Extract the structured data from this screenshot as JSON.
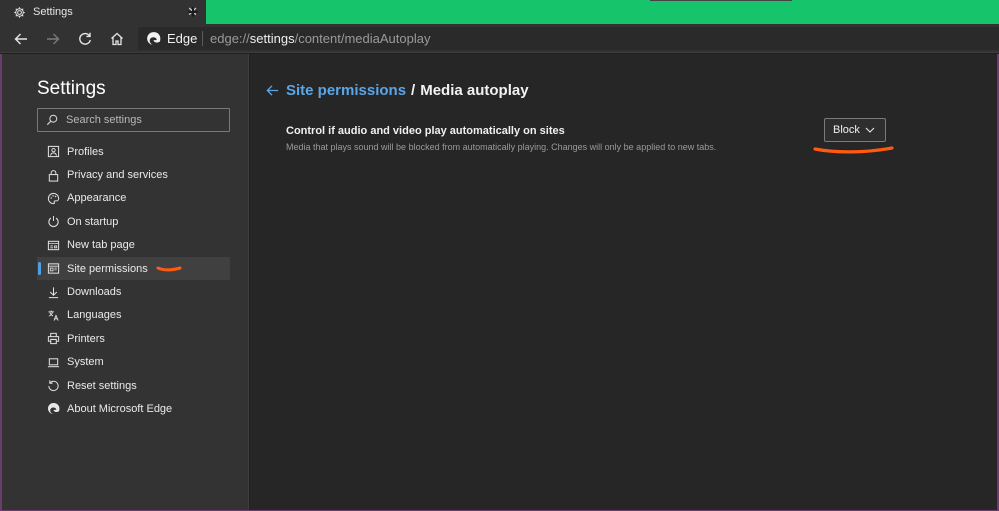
{
  "window": {
    "tab_title": "Settings",
    "tab_icon": "gear-icon",
    "close_glyph": "✕",
    "new_tab_glyph": "+"
  },
  "toolbar": {
    "brand": "Edge",
    "url_scheme": "edge://",
    "url_host": "settings",
    "url_path": "/content/mediaAutoplay"
  },
  "sidebar": {
    "title": "Settings",
    "search_placeholder": "Search settings",
    "items": [
      {
        "label": "Profiles",
        "icon": "profile-icon"
      },
      {
        "label": "Privacy and services",
        "icon": "lock-icon"
      },
      {
        "label": "Appearance",
        "icon": "palette-icon"
      },
      {
        "label": "On startup",
        "icon": "power-icon"
      },
      {
        "label": "New tab page",
        "icon": "new-tab-icon"
      },
      {
        "label": "Site permissions",
        "icon": "site-permissions-icon",
        "selected": true
      },
      {
        "label": "Downloads",
        "icon": "download-icon"
      },
      {
        "label": "Languages",
        "icon": "languages-icon"
      },
      {
        "label": "Printers",
        "icon": "printer-icon"
      },
      {
        "label": "System",
        "icon": "laptop-icon"
      },
      {
        "label": "Reset settings",
        "icon": "reset-icon"
      },
      {
        "label": "About Microsoft Edge",
        "icon": "edge-logo-icon"
      }
    ]
  },
  "main": {
    "breadcrumb_link": "Site permissions",
    "breadcrumb_sep": "/",
    "breadcrumb_current": "Media autoplay",
    "setting_title": "Control if audio and video play automatically on sites",
    "setting_description": "Media that plays sound will be blocked from automatically playing. Changes will only be applied to new tabs.",
    "autoplay_value": "Block"
  },
  "colors": {
    "accent": "#16c46c",
    "link": "#5aa6e6",
    "annotation": "#ff5a10"
  }
}
